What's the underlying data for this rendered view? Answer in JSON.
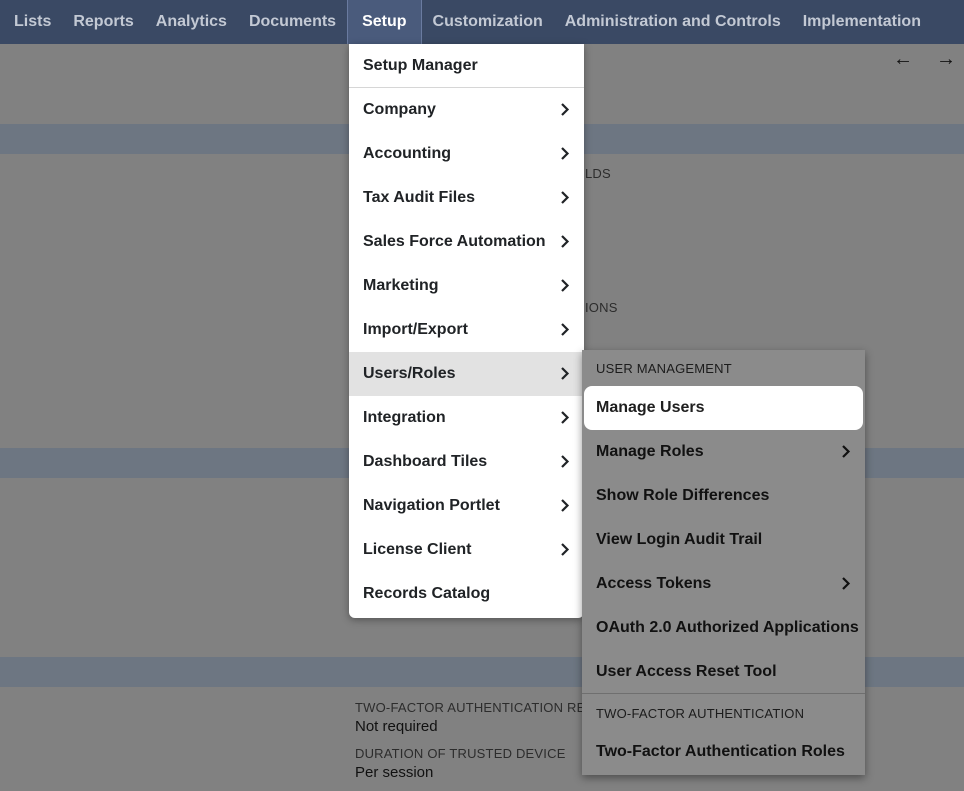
{
  "nav": {
    "items": [
      "Lists",
      "Reports",
      "Analytics",
      "Documents",
      "Setup",
      "Customization",
      "Administration and Controls",
      "Implementation"
    ],
    "active": "Setup"
  },
  "page": {
    "arrow_back": "←",
    "arrow_forward": "→",
    "label_fields": "LDS",
    "label_options": "IONS",
    "two_factor_label": "TWO-FACTOR AUTHENTICATION REQ",
    "two_factor_value": "Not required",
    "trusted_device_label": "DURATION OF TRUSTED DEVICE",
    "trusted_device_value": "Per session"
  },
  "setup_menu": {
    "header": "Setup Manager",
    "items": [
      "Company",
      "Accounting",
      "Tax Audit Files",
      "Sales Force Automation",
      "Marketing",
      "Import/Export",
      "Users/Roles",
      "Integration",
      "Dashboard Tiles",
      "Navigation Portlet",
      "License Client",
      "Records Catalog"
    ],
    "highlighted": "Users/Roles"
  },
  "users_roles_submenu": {
    "section1": "USER MANAGEMENT",
    "section1_items": [
      "Manage Users",
      "Manage Roles",
      "Show Role Differences",
      "View Login Audit Trail",
      "Access Tokens",
      "OAuth 2.0 Authorized Applications",
      "User Access Reset Tool"
    ],
    "section2": "TWO-FACTOR AUTHENTICATION",
    "section2_items": [
      "Two-Factor Authentication Roles"
    ],
    "selected": "Manage Users"
  },
  "colors": {
    "navbar": "#3a4964",
    "navbar_active": "#4a5b7c",
    "overlay": "#818181",
    "menu_bg": "#ffffff",
    "menu_highlight": "#e2e2e2"
  }
}
